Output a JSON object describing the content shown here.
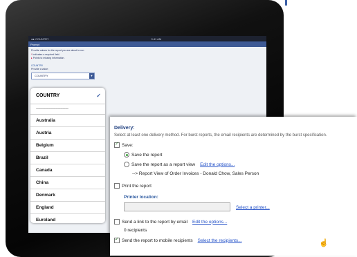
{
  "tablet": {
    "status_left": "●● COUNTRY",
    "status_time": "9:41 AM",
    "title": "Prompt",
    "prompt_intro": "Provide values for the report you are about to run.",
    "bullet_required": "Indicates a required field.",
    "bullet_missing": "Points to missing information.",
    "country_heading": "COUNTRY",
    "provide_value": "Provide a value:",
    "selected_value": "COUNTRY",
    "cancel_label": "Cancel"
  },
  "dropdown": {
    "header": "COUNTRY",
    "separator": "----------------------------------------",
    "items": [
      "Australia",
      "Austria",
      "Belgium",
      "Brazil",
      "Canada",
      "China",
      "Denmark",
      "England",
      "Euroland"
    ]
  },
  "delivery": {
    "title": "Delivery:",
    "instruction": "Select at least one delivery method. For burst reports, the email recipients are determined by the burst specification.",
    "save": {
      "label": "Save:",
      "checked": true
    },
    "save_report": {
      "label": "Save the report",
      "selected": true
    },
    "save_view": {
      "label": "Save the report as a report view",
      "link": "Edit the options..."
    },
    "view_path": "--> Report View of Order Invoices - Donald Chow, Sales Person",
    "print": {
      "label": "Print the report",
      "checked": false
    },
    "printer_location": "Printer location:",
    "select_printer": "Select a printer...",
    "email": {
      "label": "Send a link to the report by email",
      "link": "Edit the options...",
      "checked": false
    },
    "recipients_count": "0 recipients",
    "mobile": {
      "label": "Send the report to mobile recipients",
      "link": "Select the recipients...",
      "checked": true
    }
  }
}
